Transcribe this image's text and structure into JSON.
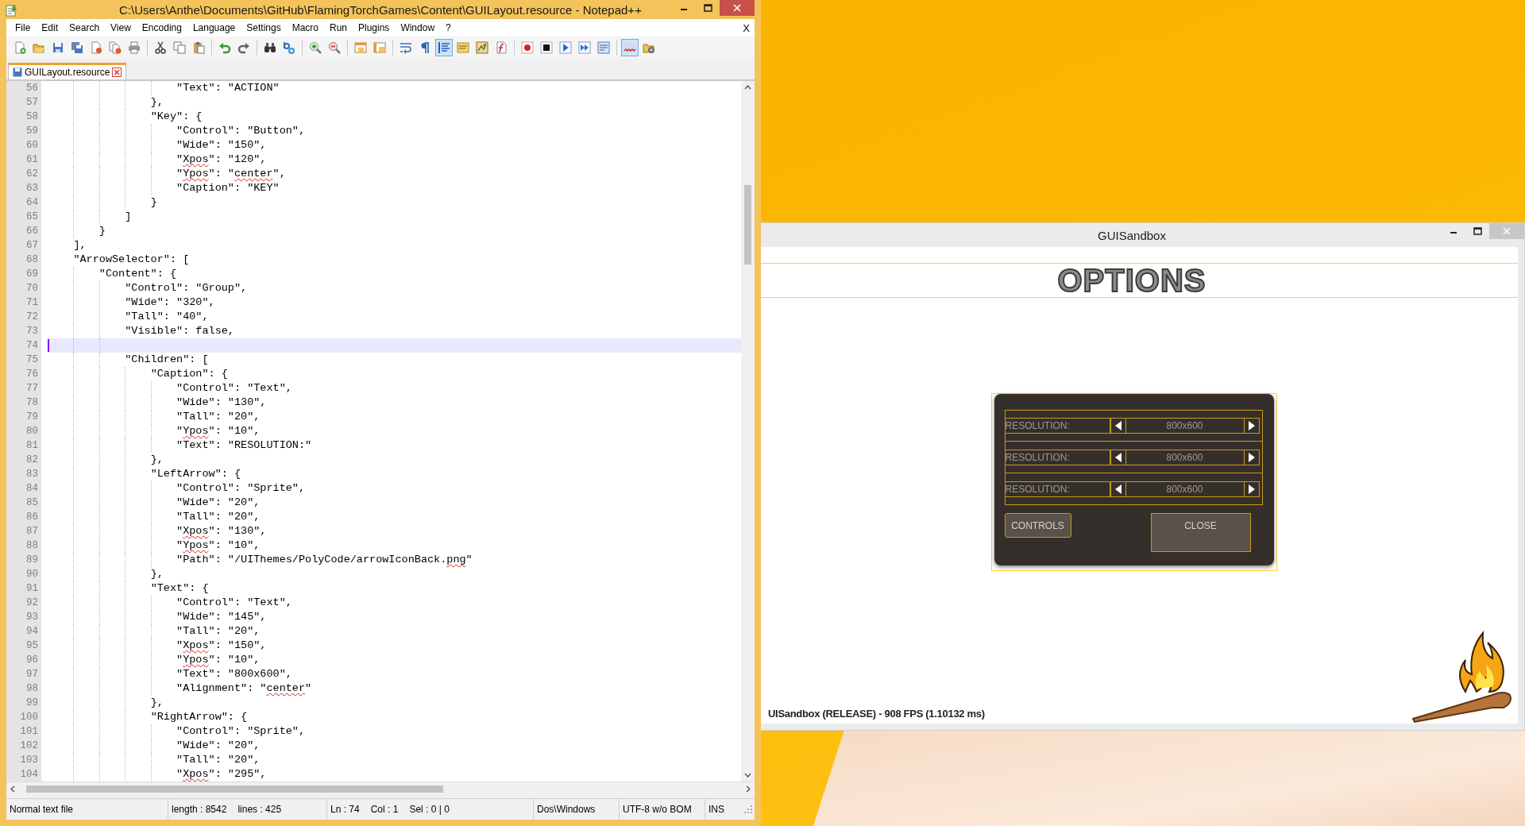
{
  "notepad": {
    "title": "C:\\Users\\Anthe\\Documents\\GitHub\\FlamingTorchGames\\Content\\GUILayout.resource - Notepad++",
    "menu": [
      "File",
      "Edit",
      "Search",
      "View",
      "Encoding",
      "Language",
      "Settings",
      "Macro",
      "Run",
      "Plugins",
      "Window",
      "?"
    ],
    "menu_close": "X",
    "toolbar": [
      [
        {
          "kind": "new",
          "pressed": false
        },
        {
          "kind": "open",
          "pressed": false
        },
        {
          "kind": "save",
          "pressed": false
        },
        {
          "kind": "saveall",
          "pressed": false
        },
        {
          "kind": "close",
          "pressed": false
        },
        {
          "kind": "closeall",
          "pressed": false
        },
        {
          "kind": "print",
          "pressed": false
        }
      ],
      [
        {
          "kind": "cut",
          "pressed": false
        },
        {
          "kind": "copy",
          "pressed": false
        },
        {
          "kind": "paste",
          "pressed": false
        }
      ],
      [
        {
          "kind": "undo",
          "pressed": false
        },
        {
          "kind": "redo",
          "pressed": false
        }
      ],
      [
        {
          "kind": "find",
          "pressed": false
        },
        {
          "kind": "replace",
          "pressed": false
        }
      ],
      [
        {
          "kind": "zoomin",
          "pressed": false
        },
        {
          "kind": "zoomout",
          "pressed": false
        }
      ],
      [
        {
          "kind": "syncv",
          "pressed": false
        },
        {
          "kind": "synch",
          "pressed": false
        }
      ],
      [
        {
          "kind": "wrap",
          "pressed": false
        },
        {
          "kind": "pilcrow",
          "pressed": false
        },
        {
          "kind": "indent",
          "pressed": true
        },
        {
          "kind": "userlang",
          "pressed": false
        },
        {
          "kind": "docmap",
          "pressed": false
        },
        {
          "kind": "funclist",
          "pressed": false
        }
      ],
      [
        {
          "kind": "record",
          "pressed": false
        },
        {
          "kind": "stop",
          "pressed": false
        },
        {
          "kind": "play",
          "pressed": false
        },
        {
          "kind": "playmulti",
          "pressed": false
        },
        {
          "kind": "savemacro",
          "pressed": false
        }
      ],
      [
        {
          "kind": "spell",
          "pressed": true
        },
        {
          "kind": "plugin",
          "pressed": false
        }
      ]
    ],
    "tabs": [
      {
        "label": "GUILayout.resource",
        "selected": true
      }
    ],
    "editor": {
      "lines": [
        {
          "number": "56",
          "current": false,
          "parts": [
            {
              "text": "                    \"Text\": \"ACTION\"",
              "misspelled": false
            }
          ]
        },
        {
          "number": "57",
          "current": false,
          "parts": [
            {
              "text": "                },",
              "misspelled": false
            }
          ]
        },
        {
          "number": "58",
          "current": false,
          "parts": [
            {
              "text": "                \"Key\": {",
              "misspelled": false
            }
          ]
        },
        {
          "number": "59",
          "current": false,
          "parts": [
            {
              "text": "                    \"Control\": \"Button\",",
              "misspelled": false
            }
          ]
        },
        {
          "number": "60",
          "current": false,
          "parts": [
            {
              "text": "                    \"Wide\": \"150\",",
              "misspelled": false
            }
          ]
        },
        {
          "number": "61",
          "current": false,
          "parts": [
            {
              "text": "                    \"",
              "misspelled": false
            },
            {
              "text": "Xpos",
              "misspelled": true
            },
            {
              "text": "\": \"120\",",
              "misspelled": false
            }
          ]
        },
        {
          "number": "62",
          "current": false,
          "parts": [
            {
              "text": "                    \"",
              "misspelled": false
            },
            {
              "text": "Ypos",
              "misspelled": true
            },
            {
              "text": "\": \"",
              "misspelled": false
            },
            {
              "text": "center",
              "misspelled": true
            },
            {
              "text": "\",",
              "misspelled": false
            }
          ]
        },
        {
          "number": "63",
          "current": false,
          "parts": [
            {
              "text": "                    \"Caption\": \"KEY\"",
              "misspelled": false
            }
          ]
        },
        {
          "number": "64",
          "current": false,
          "parts": [
            {
              "text": "                }",
              "misspelled": false
            }
          ]
        },
        {
          "number": "65",
          "current": false,
          "parts": [
            {
              "text": "            ]",
              "misspelled": false
            }
          ]
        },
        {
          "number": "66",
          "current": false,
          "parts": [
            {
              "text": "        }",
              "misspelled": false
            }
          ]
        },
        {
          "number": "67",
          "current": false,
          "parts": [
            {
              "text": "    ],",
              "misspelled": false
            }
          ]
        },
        {
          "number": "68",
          "current": false,
          "parts": [
            {
              "text": "    \"ArrowSelector\": [",
              "misspelled": false
            }
          ]
        },
        {
          "number": "69",
          "current": false,
          "parts": [
            {
              "text": "        \"Content\": {",
              "misspelled": false
            }
          ]
        },
        {
          "number": "70",
          "current": false,
          "parts": [
            {
              "text": "            \"Control\": \"Group\",",
              "misspelled": false
            }
          ]
        },
        {
          "number": "71",
          "current": false,
          "parts": [
            {
              "text": "            \"Wide\": \"320\",",
              "misspelled": false
            }
          ]
        },
        {
          "number": "72",
          "current": false,
          "parts": [
            {
              "text": "            \"Tall\": \"40\",",
              "misspelled": false
            }
          ]
        },
        {
          "number": "73",
          "current": false,
          "parts": [
            {
              "text": "            \"Visible\": false,",
              "misspelled": false
            }
          ]
        },
        {
          "number": "74",
          "current": true
        },
        {
          "number": "75",
          "current": false,
          "parts": [
            {
              "text": "            \"Children\": [",
              "misspelled": false
            }
          ]
        },
        {
          "number": "76",
          "current": false,
          "parts": [
            {
              "text": "                \"Caption\": {",
              "misspelled": false
            }
          ]
        },
        {
          "number": "77",
          "current": false,
          "parts": [
            {
              "text": "                    \"Control\": \"Text\",",
              "misspelled": false
            }
          ]
        },
        {
          "number": "78",
          "current": false,
          "parts": [
            {
              "text": "                    \"Wide\": \"130\",",
              "misspelled": false
            }
          ]
        },
        {
          "number": "79",
          "current": false,
          "parts": [
            {
              "text": "                    \"Tall\": \"20\",",
              "misspelled": false
            }
          ]
        },
        {
          "number": "80",
          "current": false,
          "parts": [
            {
              "text": "                    \"",
              "misspelled": false
            },
            {
              "text": "Ypos",
              "misspelled": true
            },
            {
              "text": "\": \"10\",",
              "misspelled": false
            }
          ]
        },
        {
          "number": "81",
          "current": false,
          "parts": [
            {
              "text": "                    \"Text\": \"RESOLUTION:\"",
              "misspelled": false
            }
          ]
        },
        {
          "number": "82",
          "current": false,
          "parts": [
            {
              "text": "                },",
              "misspelled": false
            }
          ]
        },
        {
          "number": "83",
          "current": false,
          "parts": [
            {
              "text": "                \"LeftArrow\": {",
              "misspelled": false
            }
          ]
        },
        {
          "number": "84",
          "current": false,
          "parts": [
            {
              "text": "                    \"Control\": \"Sprite\",",
              "misspelled": false
            }
          ]
        },
        {
          "number": "85",
          "current": false,
          "parts": [
            {
              "text": "                    \"Wide\": \"20\",",
              "misspelled": false
            }
          ]
        },
        {
          "number": "86",
          "current": false,
          "parts": [
            {
              "text": "                    \"Tall\": \"20\",",
              "misspelled": false
            }
          ]
        },
        {
          "number": "87",
          "current": false,
          "parts": [
            {
              "text": "                    \"",
              "misspelled": false
            },
            {
              "text": "Xpos",
              "misspelled": true
            },
            {
              "text": "\": \"130\",",
              "misspelled": false
            }
          ]
        },
        {
          "number": "88",
          "current": false,
          "parts": [
            {
              "text": "                    \"",
              "misspelled": false
            },
            {
              "text": "Ypos",
              "misspelled": true
            },
            {
              "text": "\": \"10\",",
              "misspelled": false
            }
          ]
        },
        {
          "number": "89",
          "current": false,
          "parts": [
            {
              "text": "                    \"Path\": \"/UIThemes/PolyCode/arrowIconBack.",
              "misspelled": false
            },
            {
              "text": "png",
              "misspelled": true
            },
            {
              "text": "\"",
              "misspelled": false
            }
          ]
        },
        {
          "number": "90",
          "current": false,
          "parts": [
            {
              "text": "                },",
              "misspelled": false
            }
          ]
        },
        {
          "number": "91",
          "current": false,
          "parts": [
            {
              "text": "                \"Text\": {",
              "misspelled": false
            }
          ]
        },
        {
          "number": "92",
          "current": false,
          "parts": [
            {
              "text": "                    \"Control\": \"Text\",",
              "misspelled": false
            }
          ]
        },
        {
          "number": "93",
          "current": false,
          "parts": [
            {
              "text": "                    \"Wide\": \"145\",",
              "misspelled": false
            }
          ]
        },
        {
          "number": "94",
          "current": false,
          "parts": [
            {
              "text": "                    \"Tall\": \"20\",",
              "misspelled": false
            }
          ]
        },
        {
          "number": "95",
          "current": false,
          "parts": [
            {
              "text": "                    \"",
              "misspelled": false
            },
            {
              "text": "Xpos",
              "misspelled": true
            },
            {
              "text": "\": \"150\",",
              "misspelled": false
            }
          ]
        },
        {
          "number": "96",
          "current": false,
          "parts": [
            {
              "text": "                    \"",
              "misspelled": false
            },
            {
              "text": "Ypos",
              "misspelled": true
            },
            {
              "text": "\": \"10\",",
              "misspelled": false
            }
          ]
        },
        {
          "number": "97",
          "current": false,
          "parts": [
            {
              "text": "                    \"Text\": \"800x600\",",
              "misspelled": false
            }
          ]
        },
        {
          "number": "98",
          "current": false,
          "parts": [
            {
              "text": "                    \"Alignment\": \"",
              "misspelled": false
            },
            {
              "text": "center",
              "misspelled": true
            },
            {
              "text": "\"",
              "misspelled": false
            }
          ]
        },
        {
          "number": "99",
          "current": false,
          "parts": [
            {
              "text": "                },",
              "misspelled": false
            }
          ]
        },
        {
          "number": "100",
          "current": false,
          "parts": [
            {
              "text": "                \"RightArrow\": {",
              "misspelled": false
            }
          ]
        },
        {
          "number": "101",
          "current": false,
          "parts": [
            {
              "text": "                    \"Control\": \"Sprite\",",
              "misspelled": false
            }
          ]
        },
        {
          "number": "102",
          "current": false,
          "parts": [
            {
              "text": "                    \"Wide\": \"20\",",
              "misspelled": false
            }
          ]
        },
        {
          "number": "103",
          "current": false,
          "parts": [
            {
              "text": "                    \"Tall\": \"20\",",
              "misspelled": false
            }
          ]
        },
        {
          "number": "104",
          "current": false,
          "parts": [
            {
              "text": "                    \"",
              "misspelled": false
            },
            {
              "text": "Xpos",
              "misspelled": true
            },
            {
              "text": "\": \"295\",",
              "misspelled": false
            }
          ]
        }
      ]
    },
    "status_bar": {
      "file_type": "Normal text file",
      "length": "length : 8542",
      "lines": "lines : 425",
      "line": "Ln : 74",
      "column": "Col : 1",
      "selection": "Sel : 0 | 0",
      "line_endings": "Dos\\Windows",
      "encoding": "UTF-8 w/o BOM",
      "mode": "INS"
    }
  },
  "sandbox": {
    "title": "GUISandbox",
    "heading": "OPTIONS",
    "selectors": [
      {
        "caption": "RESOLUTION:",
        "value": "800x600"
      },
      {
        "caption": "RESOLUTION:",
        "value": "800x600"
      },
      {
        "caption": "RESOLUTION:",
        "value": "800x600"
      }
    ],
    "buttons": [
      {
        "label": "CONTROLS",
        "kind": "small"
      },
      {
        "label": "CLOSE",
        "kind": "large"
      }
    ],
    "status": "UISandbox (RELEASE) - 908 FPS (1.10132 ms)"
  }
}
